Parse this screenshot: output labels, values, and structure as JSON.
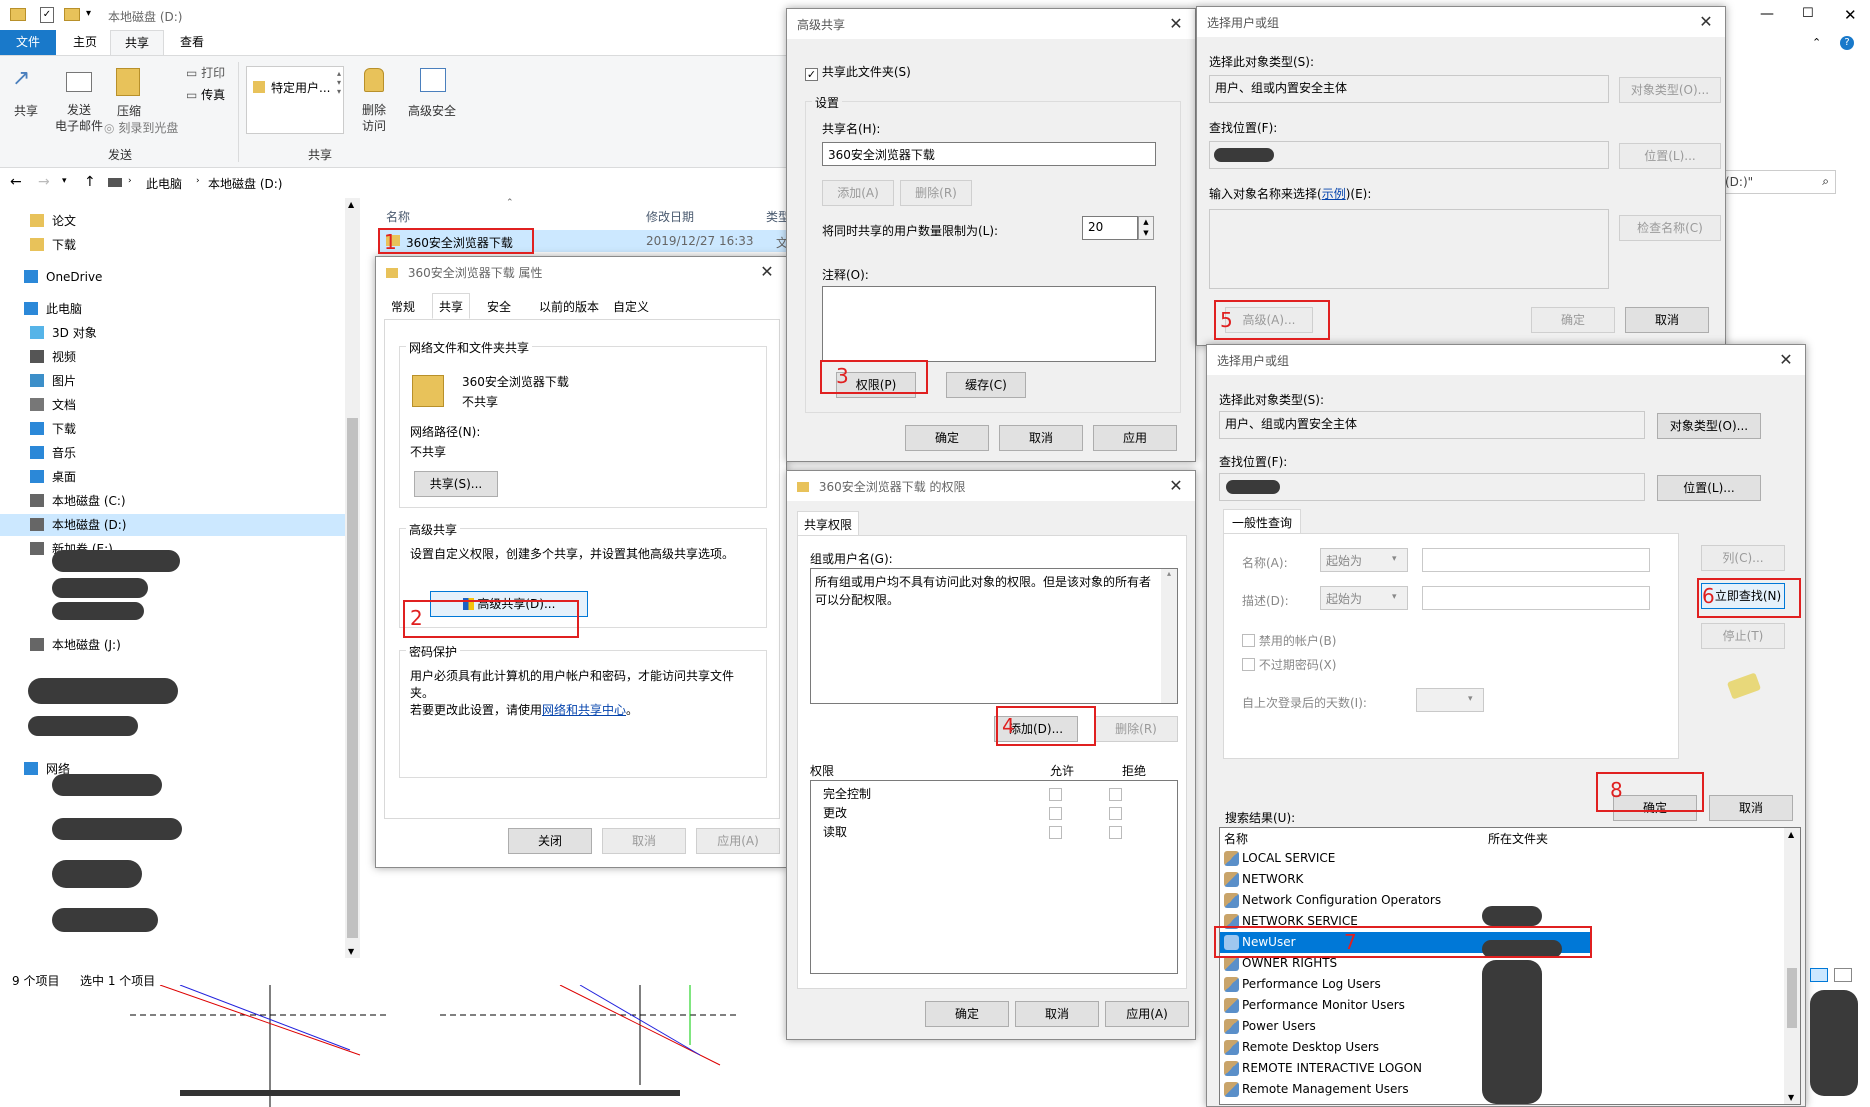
{
  "explorer": {
    "title": "本地磁盘 (D:)",
    "ribbon_tabs": [
      "文件",
      "主页",
      "共享",
      "查看"
    ],
    "ribbon": {
      "share": "共享",
      "email": "发送\n电子邮件",
      "zip": "压缩",
      "print": "打印",
      "fax": "传真",
      "burn": "刻录到光盘",
      "group_send": "发送",
      "specific_users": "特定用户...",
      "group_share": "共享",
      "remove_access": "删除\n访问",
      "adv_security": "高级安全"
    },
    "address": [
      "此电脑",
      "本地磁盘 (D:)"
    ],
    "search_placeholder": "(D:)\"",
    "columns": {
      "name": "名称",
      "date": "修改日期",
      "type": "类型"
    },
    "row": {
      "name": "360安全浏览器下载",
      "date": "2019/12/27 16:33",
      "type": "文件"
    },
    "nav": [
      {
        "label": "论文",
        "icon": "folder-icon"
      },
      {
        "label": "下载",
        "icon": "folder-icon"
      },
      {
        "label": "OneDrive",
        "icon": "cloud-icon"
      },
      {
        "label": "此电脑",
        "icon": "computer-icon"
      },
      {
        "label": "3D 对象",
        "icon": "cube-icon"
      },
      {
        "label": "视频",
        "icon": "video-icon"
      },
      {
        "label": "图片",
        "icon": "picture-icon"
      },
      {
        "label": "文档",
        "icon": "document-icon"
      },
      {
        "label": "下载",
        "icon": "download-icon"
      },
      {
        "label": "音乐",
        "icon": "music-icon"
      },
      {
        "label": "桌面",
        "icon": "desktop-icon"
      },
      {
        "label": "本地磁盘 (C:)",
        "icon": "drive-icon"
      },
      {
        "label": "本地磁盘 (D:)",
        "icon": "drive-icon"
      },
      {
        "label": "新加卷 (E:)",
        "icon": "drive-icon"
      },
      {
        "label": "本地磁盘 (J:)",
        "icon": "drive-icon"
      },
      {
        "label": "网络",
        "icon": "network-icon"
      }
    ],
    "status": {
      "count": "9 个项目",
      "selected": "选中 1 个项目"
    }
  },
  "props": {
    "title": "360安全浏览器下载 属性",
    "tabs": [
      "常规",
      "共享",
      "安全",
      "以前的版本",
      "自定义"
    ],
    "net_share_title": "网络文件和文件夹共享",
    "folder_name": "360安全浏览器下载",
    "share_state": "不共享",
    "net_path_label": "网络路径(N):",
    "net_path": "不共享",
    "share_btn": "共享(S)...",
    "adv_title": "高级共享",
    "adv_desc": "设置自定义权限，创建多个共享，并设置其他高级共享选项。",
    "adv_btn": "高级共享(D)...",
    "pwd_title": "密码保护",
    "pwd_desc": "用户必须具有此计算机的用户帐户和密码，才能访问共享文件夹。",
    "pwd_change_prefix": "若要更改此设置，请使用",
    "pwd_link": "网络和共享中心",
    "pwd_suffix": "。",
    "close": "关闭",
    "cancel": "取消",
    "apply": "应用(A)"
  },
  "adv": {
    "title": "高级共享",
    "share_check": "共享此文件夹(S)",
    "settings": "设置",
    "share_name_label": "共享名(H):",
    "share_name": "360安全浏览器下载",
    "add": "添加(A)",
    "remove": "删除(R)",
    "limit_label": "将同时共享的用户数量限制为(L):",
    "limit": "20",
    "comment_label": "注释(O):",
    "perm_btn": "权限(P)",
    "cache_btn": "缓存(C)",
    "ok": "确定",
    "cancel": "取消",
    "apply": "应用"
  },
  "perm": {
    "title": "360安全浏览器下载 的权限",
    "tab": "共享权限",
    "group_label": "组或用户名(G):",
    "group_msg": "所有组或用户均不具有访问此对象的权限。但是该对象的所有者可以分配权限。",
    "add": "添加(D)...",
    "remove": "删除(R)",
    "perm_label": "权限",
    "allow": "允许",
    "deny": "拒绝",
    "rows": [
      "完全控制",
      "更改",
      "读取"
    ],
    "ok": "确定",
    "cancel": "取消",
    "apply": "应用(A)"
  },
  "sel1": {
    "title": "选择用户或组",
    "type_label": "选择此对象类型(S):",
    "type_value": "用户、组或内置安全主体",
    "type_btn": "对象类型(O)...",
    "loc_label": "查找位置(F):",
    "loc_btn": "位置(L)...",
    "enter_label_a": "输入对象名称来选择(",
    "enter_link": "示例",
    "enter_label_b": ")(E):",
    "check_btn": "检查名称(C)",
    "advanced": "高级(A)...",
    "ok": "确定",
    "cancel": "取消"
  },
  "sel2": {
    "title": "选择用户或组",
    "type_label": "选择此对象类型(S):",
    "type_value": "用户、组或内置安全主体",
    "type_btn": "对象类型(O)...",
    "loc_label": "查找位置(F):",
    "loc_btn": "位置(L)...",
    "tab": "一般性查询",
    "name_label": "名称(A):",
    "desc_label": "描述(D):",
    "starts_with": "起始为",
    "columns_btn": "列(C)...",
    "find_btn": "立即查找(N)",
    "stop_btn": "停止(T)",
    "disabled_acc": "禁用的帐户(B)",
    "no_expire": "不过期密码(X)",
    "days_label": "自上次登录后的天数(I):",
    "results_label": "搜索结果(U):",
    "ok": "确定",
    "cancel": "取消",
    "col_name": "名称",
    "col_folder": "所在文件夹",
    "results": [
      "LOCAL SERVICE",
      "NETWORK",
      "Network Configuration Operators",
      "NETWORK SERVICE",
      "NewUser",
      "OWNER RIGHTS",
      "Performance Log Users",
      "Performance Monitor Users",
      "Power Users",
      "Remote Desktop Users",
      "REMOTE INTERACTIVE LOGON",
      "Remote Management Users"
    ]
  },
  "steps": [
    "1",
    "2",
    "3",
    "4",
    "5",
    "6",
    "7",
    "8"
  ],
  "colors": {
    "accent": "#0078d7",
    "selection": "#0078d7",
    "highlight": "#e02020",
    "link": "#0645ad"
  }
}
